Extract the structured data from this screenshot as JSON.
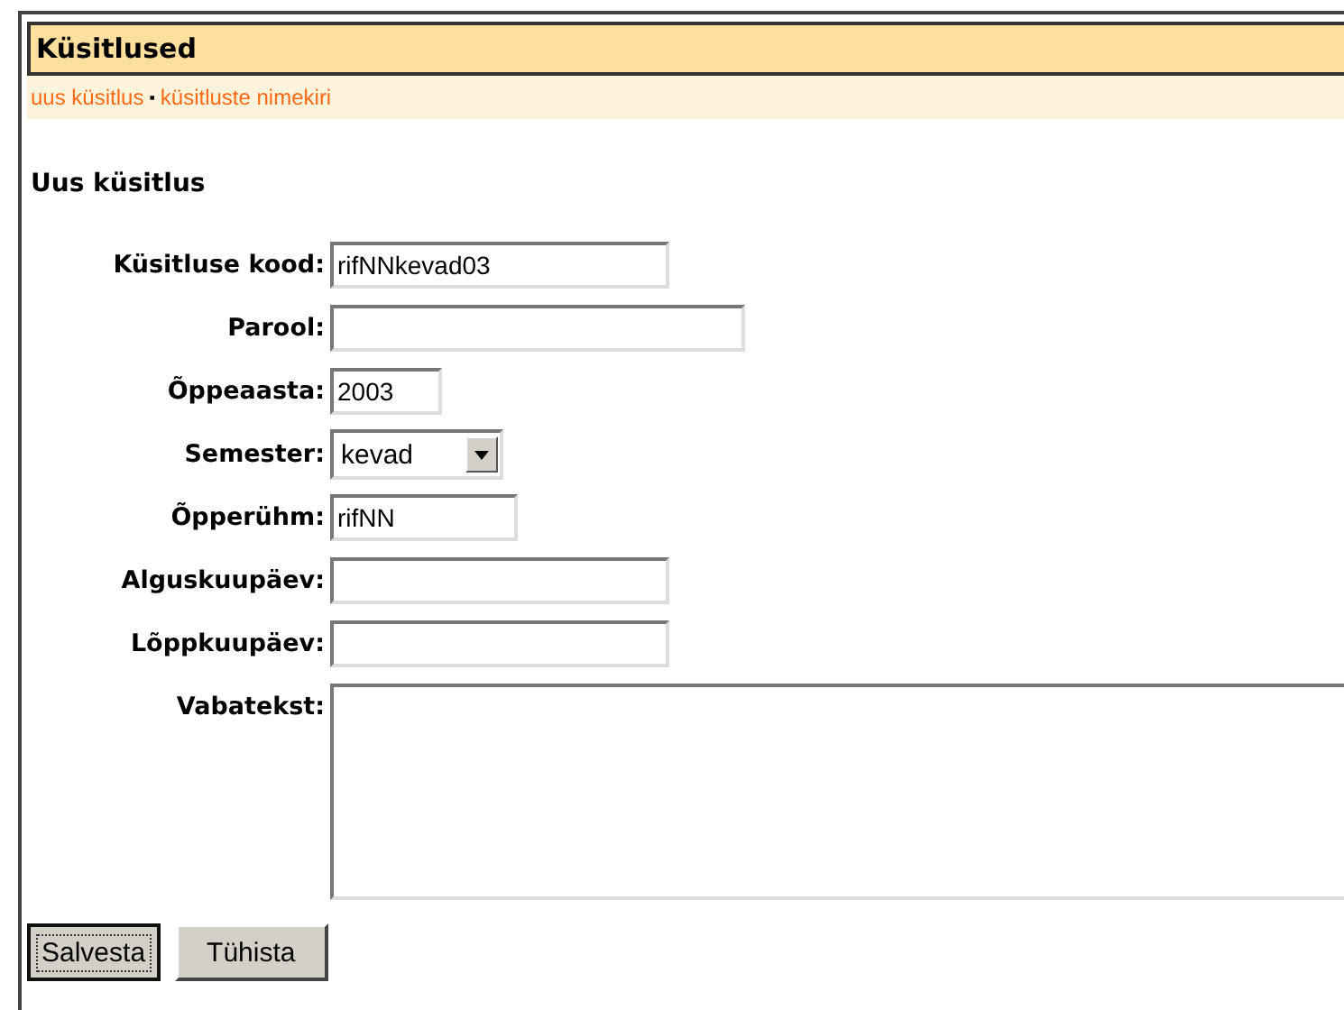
{
  "header": {
    "title": "Küsitlused"
  },
  "nav": [
    {
      "label": "uus küsitlus",
      "separator": "▪"
    },
    {
      "label": "küsitluste nimekiri"
    }
  ],
  "heading": "Uus küsitlus",
  "fields": [
    {
      "kind": "text",
      "label": "Küsitluse kood:",
      "value": "rifNNkevad03"
    },
    {
      "kind": "text",
      "label": "Parool:"
    },
    {
      "kind": "text",
      "label": "Õppeaasta:",
      "value": "2003"
    },
    {
      "kind": "select",
      "label": "Semester:",
      "value": "kevad"
    },
    {
      "kind": "text",
      "label": "Õpperühm:",
      "value": "rifNN"
    },
    {
      "kind": "text",
      "label": "Alguskuupäev:"
    },
    {
      "kind": "text",
      "label": "Lõppkuupäev:"
    },
    {
      "kind": "textarea",
      "label": "Vabatekst:"
    }
  ],
  "buttons": [
    {
      "label": "Salvesta",
      "focused": true
    },
    {
      "label": "Tühista",
      "focused": false
    }
  ]
}
